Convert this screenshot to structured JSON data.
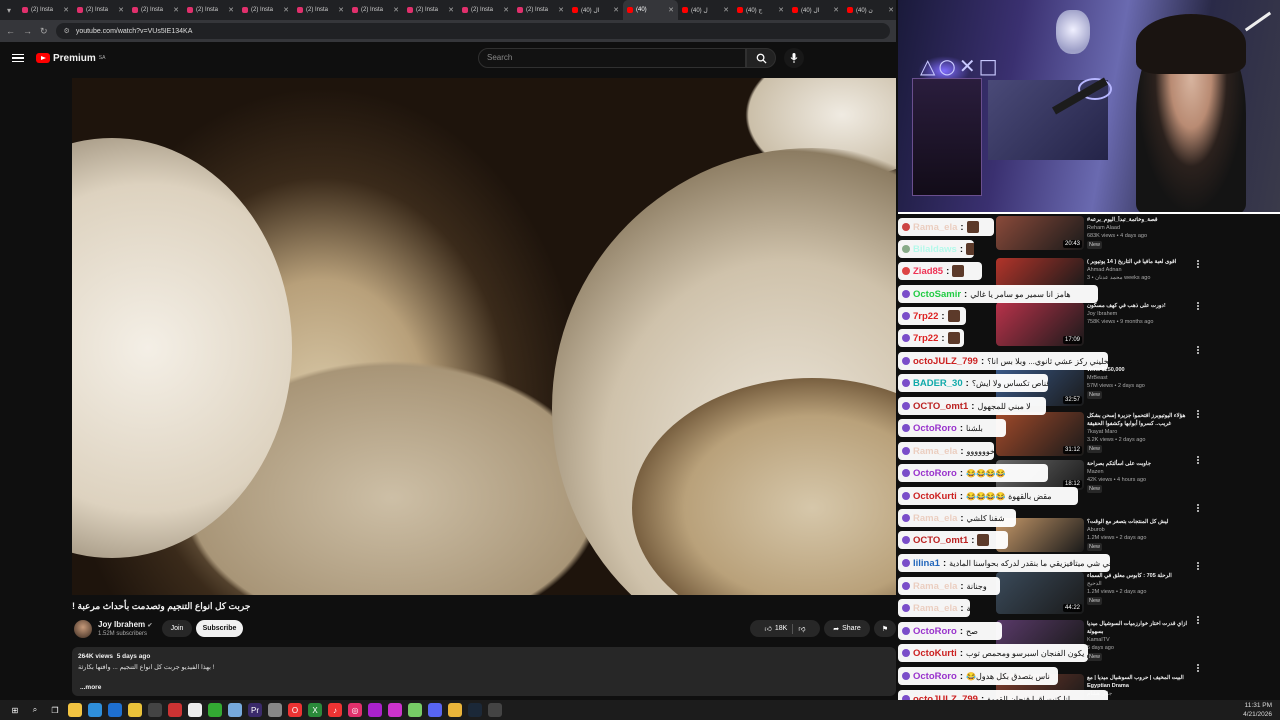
{
  "browser": {
    "tabs": [
      {
        "label": "(2) Insta",
        "color": "#e1306c"
      },
      {
        "label": "(2) Insta",
        "color": "#e1306c"
      },
      {
        "label": "(2) Insta",
        "color": "#e1306c"
      },
      {
        "label": "(2) Insta",
        "color": "#e1306c"
      },
      {
        "label": "(2) Insta",
        "color": "#e1306c"
      },
      {
        "label": "(2) Insta",
        "color": "#e1306c"
      },
      {
        "label": "(2) Insta",
        "color": "#e1306c"
      },
      {
        "label": "(2) Insta",
        "color": "#e1306c"
      },
      {
        "label": "(2) Insta",
        "color": "#e1306c"
      },
      {
        "label": "(2) Insta",
        "color": "#e1306c"
      },
      {
        "label": "(40) ال",
        "color": "#ff0000"
      },
      {
        "label": "(40)",
        "color": "#ff0000",
        "active": true
      },
      {
        "label": "(40) ل",
        "color": "#ff0000"
      },
      {
        "label": "(40) ج",
        "color": "#ff0000"
      },
      {
        "label": "(40) ال",
        "color": "#ff0000"
      },
      {
        "label": "(40) ن",
        "color": "#ff0000"
      }
    ],
    "url": "youtube.com/watch?v=VUs5IE134KA"
  },
  "youtube": {
    "logo_text": "Premium",
    "region": "SA",
    "search_placeholder": "Search"
  },
  "video": {
    "title": "! جربت كل انواع التنجيم وتصدمت بأحداث مرعبة",
    "channel": "Joy Ibrahem",
    "subscribers": "1.52M subscribers",
    "join_label": "Join",
    "subscribe_label": "Subscribe",
    "likes": "18K",
    "share_label": "Share",
    "views": "264K views",
    "age": "5 days ago",
    "description": "بهذا الفيديو جربت كل انواع التنجيم ... وافتها بكارثة !",
    "more_label": "...more"
  },
  "chat": [
    {
      "user": "Rama_ela",
      "color": "#e0a080",
      "text": "",
      "badge": "#c44",
      "faded": true
    },
    {
      "user": "Bilaldaws",
      "color": "#6fd",
      "text": "",
      "badge": "#8a8",
      "faded": true
    },
    {
      "user": "Ziad85",
      "color": "#e35",
      "text": "",
      "badge": "#d44"
    },
    {
      "user": "OctoSamir",
      "color": "#2c4",
      "text": "هامز انا سمير مو سامر يا غالي"
    },
    {
      "user": "7rp22",
      "color": "#d22",
      "text": ""
    },
    {
      "user": "7rp22",
      "color": "#d22",
      "text": ""
    },
    {
      "user": "octoJULZ_799",
      "color": "#c22",
      "text": "اختيار الالوان عم يخليني ركز عشي ثانوي... وبلا بس انا؟"
    },
    {
      "user": "BADER_30",
      "color": "#1aa",
      "text": "هل هي قناص تكساس ولا ايش؟"
    },
    {
      "user": "OCTO_omt1",
      "color": "#b22",
      "text": "لا مبني للمجهول"
    },
    {
      "user": "OctoRoro",
      "color": "#93c",
      "text": "بلشنا"
    },
    {
      "user": "Rama_ela",
      "color": "#e0a080",
      "text": "خوووووو",
      "faded": true
    },
    {
      "user": "OctoRoro",
      "color": "#93c",
      "text": "😂😂😂😂"
    },
    {
      "user": "OctoKurti",
      "color": "#c22",
      "text": "😂😂😂😂 مقض بالقهوة"
    },
    {
      "user": "Rama_ela",
      "color": "#e0a080",
      "text": "شفنا كلشي",
      "faded": true
    },
    {
      "user": "OCTO_omt1",
      "color": "#b22",
      "text": ""
    },
    {
      "user": "lilina1",
      "color": "#26b",
      "text": "حتى لو في شي ميتافيزيقي ما بنقدر لدركه بحواسنا المادية"
    },
    {
      "user": "Rama_ela",
      "color": "#e0a080",
      "text": "وجنانة",
      "faded": true
    },
    {
      "user": "Rama_ela",
      "color": "#e0a080",
      "text": "لاواللة",
      "faded": true
    },
    {
      "user": "OctoRoro",
      "color": "#93c",
      "text": "صح"
    },
    {
      "user": "OctoKurti",
      "color": "#c22",
      "text": "لازم يكون الفنجان اسبرسو ومحمص توب"
    },
    {
      "user": "OctoRoro",
      "color": "#93c",
      "text": "😂ناس بتصدق بكل هدول"
    },
    {
      "user": "octoJULZ_799",
      "color": "#c22",
      "text": "انا كنت اقرا فنجان القهوة"
    }
  ],
  "recommended": [
    {
      "title": "#قصة_وخاتمة_تبدأ_اليوم_برعه",
      "channel": "Reham Alaad",
      "meta": "683K views • 4 days ago",
      "duration": "20:43",
      "new": "New",
      "thumb": "#8a4a3a"
    },
    {
      "title": "اقوى لعبة مافيا في التاريخ ( 14 يوتيوبر )",
      "channel": "Ahmad Adnan",
      "meta": "محمد عدنان • 3 weeks ago",
      "duration": "",
      "new": "",
      "thumb": "#b2342a"
    },
    {
      "title": "دورت على ذهب في كهف مسكون!",
      "channel": "Joy Ibrahem",
      "meta": "758K views • 9 months ago",
      "duration": "17:09",
      "new": "",
      "thumb": "#b8324a"
    },
    {
      "title": "Wins $250,000",
      "channel": "MrBeast",
      "meta": "57M views • 2 days ago",
      "duration": "32:57",
      "new": "New",
      "thumb": "#3a5a8a"
    },
    {
      "title": "هؤلاء اليوتيوبرز اقتحموا جزيرة إسحن بشكل غريب.. كسروا أبوابها وكشفوا الحقيقة",
      "channel": "7kayat Maro",
      "meta": "3.2K views • 2 days ago",
      "duration": "31:12",
      "new": "New",
      "thumb": "#a24a2a"
    },
    {
      "title": "جاوبت على اسألتكم بصراحة",
      "channel": "Mazen",
      "meta": "42K views • 4 hours ago",
      "duration": "18:12",
      "new": "New",
      "thumb": "#6a6a6a"
    },
    {
      "title": "ليش كل المنتجات بتصغر مع الوقت؟",
      "channel": "Aburob",
      "meta": "1.2M views • 2 days ago",
      "duration": "",
      "new": "New",
      "thumb": "#c89a6a"
    },
    {
      "title": "الرحلة 705 : كابوس معلق في السماء",
      "channel": "الدحيح",
      "meta": "1.2M views • 2 days ago",
      "duration": "44:22",
      "new": "New",
      "thumb": "#3a4a5a"
    },
    {
      "title": "ازاي قدرت اختار خوارزميات السوشيال ميديا بسهولة",
      "channel": "KamalTV",
      "meta": "5 days ago",
      "duration": "",
      "new": "New",
      "thumb": "#5a3a6a"
    },
    {
      "title": "البيت المخيف | حروب السوشيال ميديا | مع Egyptian Drama",
      "channel": "جلال هشام",
      "meta": "",
      "duration": "",
      "new": "",
      "thumb": "#7a3a2a"
    }
  ],
  "taskbar": {
    "time": "11:31 PM",
    "date": "4/21/2026",
    "apps": [
      "start",
      "search",
      "task-view",
      "file-explorer",
      "edge",
      "outlook",
      "chrome",
      "obs",
      "steam-link",
      "quick",
      "terminal",
      "photos",
      "premiere",
      "files",
      "opera",
      "excel",
      "tiktok",
      "instagram",
      "app1",
      "app2",
      "app3",
      "discord",
      "chrome2",
      "steam",
      "obs2"
    ]
  },
  "colors": {
    "yt_red": "#ff0000",
    "bg": "#0f0f0f"
  }
}
